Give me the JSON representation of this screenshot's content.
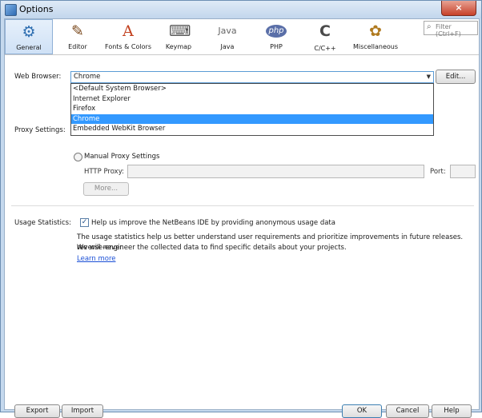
{
  "window": {
    "title": "Options",
    "close_glyph": "×"
  },
  "toolbar": {
    "categories": [
      {
        "label": "General",
        "icon": "⚙"
      },
      {
        "label": "Editor",
        "icon": "✎"
      },
      {
        "label": "Fonts & Colors",
        "icon": "A"
      },
      {
        "label": "Keymap",
        "icon": "⌨"
      },
      {
        "label": "Java",
        "icon": "Java"
      },
      {
        "label": "PHP",
        "icon": "php"
      },
      {
        "label": "C/C++",
        "icon": "C"
      },
      {
        "label": "Miscellaneous",
        "icon": "✿"
      }
    ],
    "selected": "General",
    "filter_placeholder": "Filter (Ctrl+F)"
  },
  "general": {
    "web_browser_label": "Web Browser:",
    "web_browser_value": "Chrome",
    "edit_button": "Edit...",
    "browser_options": [
      "<Default System Browser>",
      "Internet Explorer",
      "Firefox",
      "Chrome",
      "Embedded WebKit Browser"
    ],
    "browser_selected": "Chrome",
    "proxy_label": "Proxy Settings:",
    "manual_proxy_label": "Manual Proxy Settings",
    "http_proxy_label": "HTTP Proxy:",
    "port_label": "Port:",
    "more_button": "More...",
    "usage_label": "Usage Statistics:",
    "usage_checkbox_label": "Help us improve the NetBeans IDE by providing anonymous usage data",
    "usage_checked": true,
    "usage_text_1": "The usage statistics help us better understand user requirements and prioritize improvements in future releases. We will never",
    "usage_text_2": "reverse-engineer the collected data to find specific details about your projects.",
    "learn_more": "Learn more"
  },
  "footer": {
    "export": "Export",
    "import": "Import",
    "ok": "OK",
    "cancel": "Cancel",
    "help": "Help"
  },
  "colors": {
    "selection": "#3399ff",
    "link": "#1a4fd6",
    "window_border": "#6d8fb3"
  }
}
